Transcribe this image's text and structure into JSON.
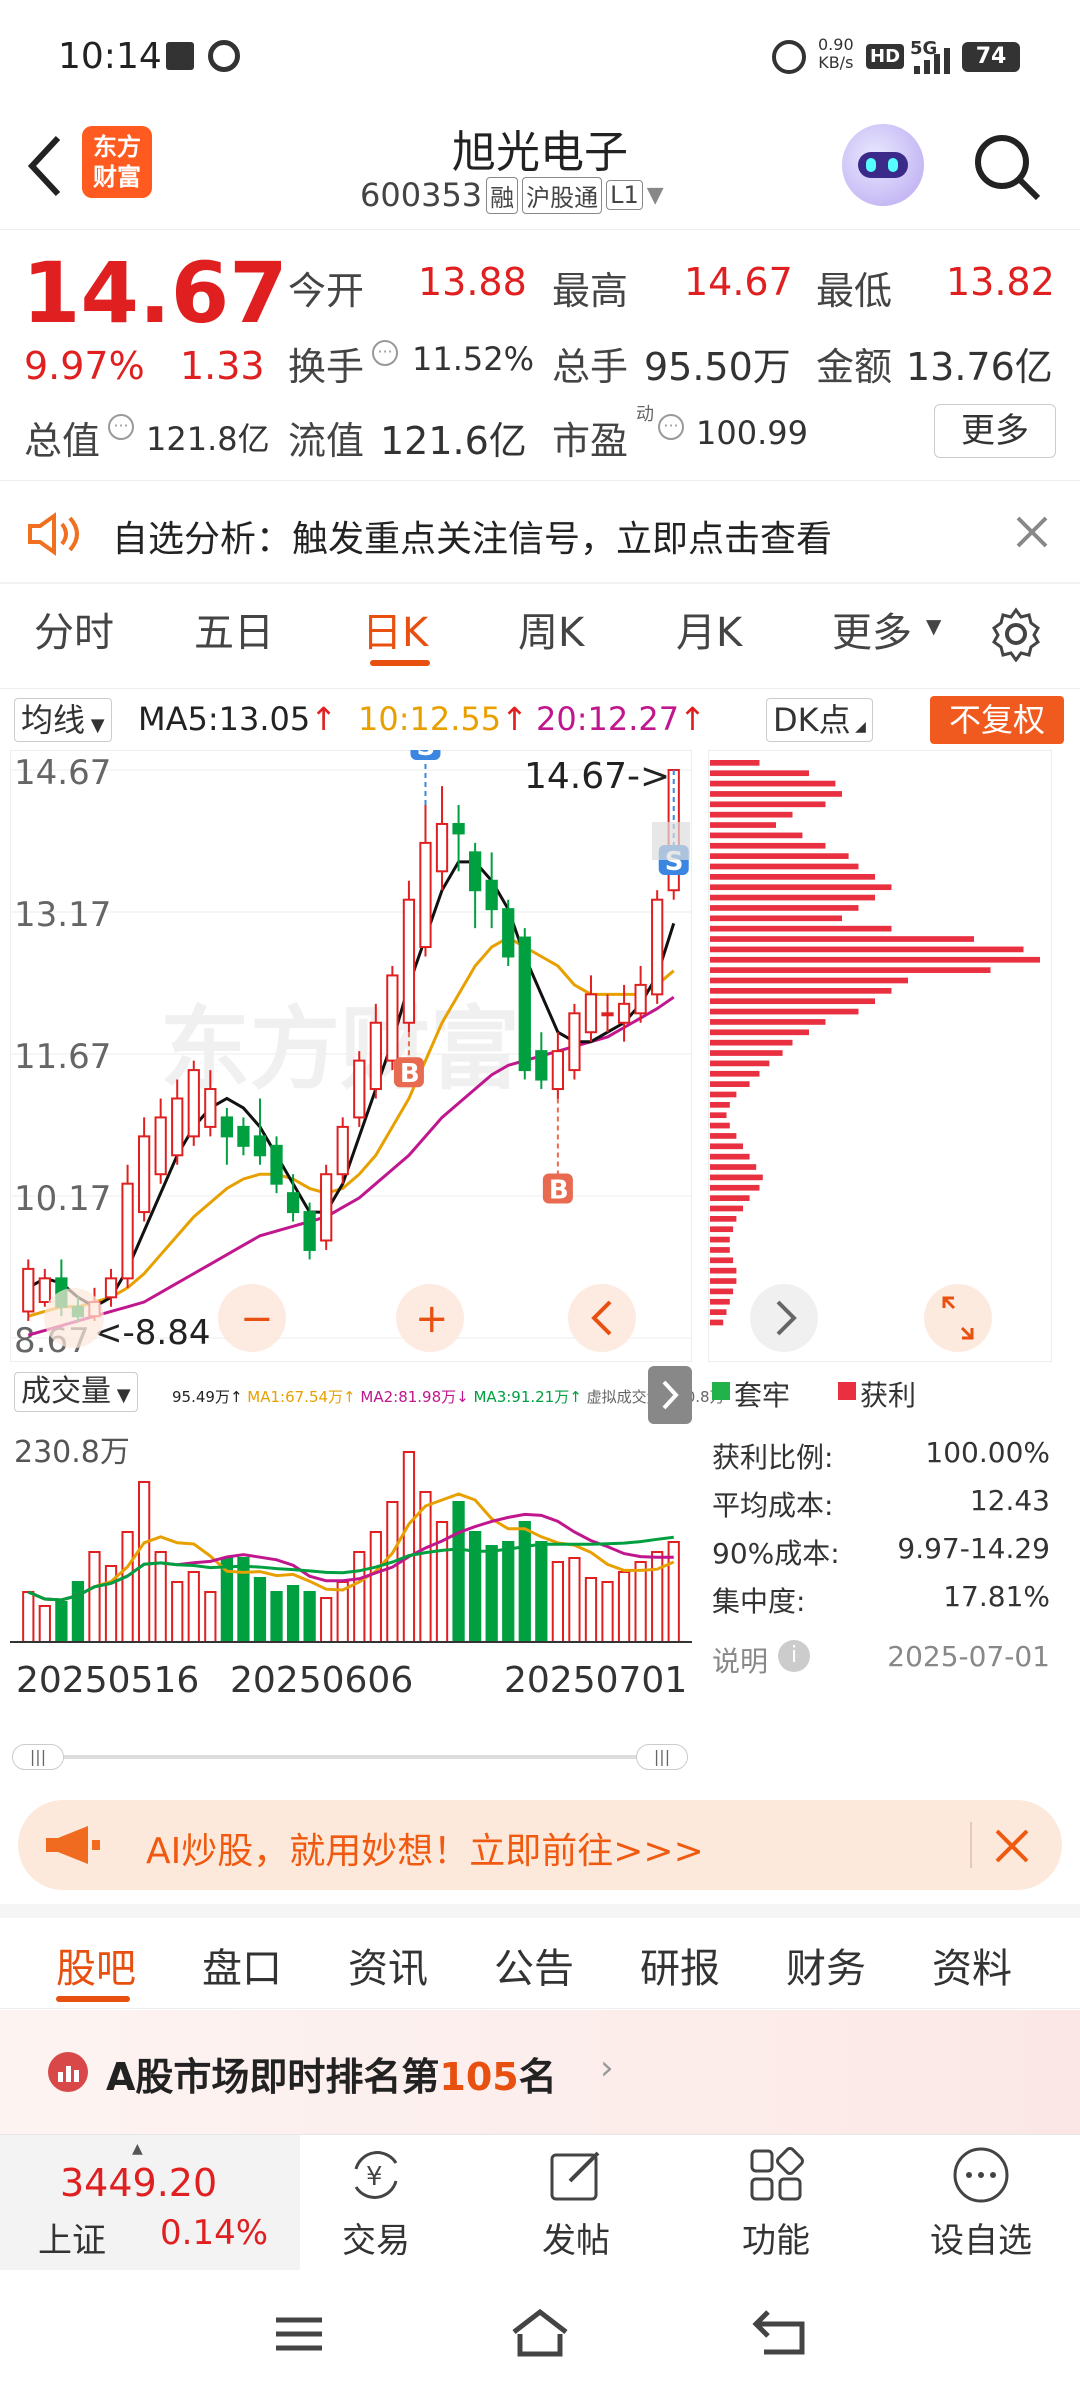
{
  "status": {
    "time": "10:14",
    "net_speed": "0.90",
    "net_unit": "KB/s",
    "hd": "HD",
    "signal": "5G",
    "battery": "74"
  },
  "header": {
    "title": "旭光电子",
    "code": "600353",
    "tag_margin": "融",
    "tag_connect": "沪股通",
    "tag_level": "L1",
    "brand_line1": "东方",
    "brand_line2": "财富"
  },
  "quote": {
    "price": "14.67",
    "change_pct": "9.97%",
    "change": "1.33",
    "open_label": "今开",
    "open": "13.88",
    "high_label": "最高",
    "high": "14.67",
    "low_label": "最低",
    "low": "13.82",
    "turnover_label": "换手",
    "turnover": "11.52%",
    "volume_label": "总手",
    "volume": "95.50万",
    "amount_label": "金额",
    "amount": "13.76亿",
    "mcap_label": "总值",
    "mcap": "121.8亿",
    "float_label": "流值",
    "float": "121.6亿",
    "pe_label": "市盈",
    "pe_sup": "动",
    "pe": "100.99",
    "more": "更多"
  },
  "banner": {
    "text": "自选分析：触发重点关注信号，立即点击查看"
  },
  "chart_tabs": [
    "分时",
    "五日",
    "日K",
    "周K",
    "月K",
    "更多"
  ],
  "ma_bar": {
    "selector": "均线",
    "ma5": "MA5:13.05",
    "ma10": "10:12.55",
    "ma20": "20:12.27",
    "dk": "DK点",
    "adjust": "不复权"
  },
  "chart_data": {
    "type": "candlestick",
    "yticks": [
      "14.67",
      "13.17",
      "11.67",
      "10.17",
      "8.67"
    ],
    "ylim": [
      8.67,
      14.67
    ],
    "last_label": "14.67->",
    "min_label": "<-8.84",
    "signals": [
      {
        "type": "B"
      },
      {
        "type": "S"
      },
      {
        "type": "B"
      },
      {
        "type": "S"
      },
      {
        "type": "S"
      }
    ],
    "candles": [
      {
        "o": 8.95,
        "c": 9.4,
        "h": 9.5,
        "l": 8.85
      },
      {
        "o": 9.05,
        "c": 9.3,
        "h": 9.4,
        "l": 9.0
      },
      {
        "o": 9.3,
        "c": 9.0,
        "h": 9.5,
        "l": 8.9
      },
      {
        "o": 9.0,
        "c": 8.9,
        "h": 9.1,
        "l": 8.84
      },
      {
        "o": 8.9,
        "c": 9.05,
        "h": 9.2,
        "l": 8.85
      },
      {
        "o": 9.1,
        "c": 9.3,
        "h": 9.4,
        "l": 9.0
      },
      {
        "o": 9.3,
        "c": 10.3,
        "h": 10.5,
        "l": 9.2
      },
      {
        "o": 10.0,
        "c": 10.8,
        "h": 11.0,
        "l": 9.9
      },
      {
        "o": 10.4,
        "c": 11.0,
        "h": 11.2,
        "l": 10.3
      },
      {
        "o": 10.6,
        "c": 11.2,
        "h": 11.4,
        "l": 10.5
      },
      {
        "o": 10.8,
        "c": 11.5,
        "h": 11.6,
        "l": 10.7
      },
      {
        "o": 10.9,
        "c": 11.3,
        "h": 11.5,
        "l": 10.8
      },
      {
        "o": 11.0,
        "c": 10.8,
        "h": 11.1,
        "l": 10.5
      },
      {
        "o": 10.9,
        "c": 10.7,
        "h": 11.0,
        "l": 10.6
      },
      {
        "o": 10.8,
        "c": 10.6,
        "h": 11.2,
        "l": 10.5
      },
      {
        "o": 10.7,
        "c": 10.3,
        "h": 10.8,
        "l": 10.2
      },
      {
        "o": 10.2,
        "c": 10.0,
        "h": 10.4,
        "l": 9.9
      },
      {
        "o": 10.0,
        "c": 9.6,
        "h": 10.1,
        "l": 9.5
      },
      {
        "o": 9.7,
        "c": 10.4,
        "h": 10.5,
        "l": 9.6
      },
      {
        "o": 10.4,
        "c": 10.9,
        "h": 11.0,
        "l": 10.3
      },
      {
        "o": 11.0,
        "c": 11.6,
        "h": 11.7,
        "l": 10.9
      },
      {
        "o": 11.3,
        "c": 12.0,
        "h": 12.2,
        "l": 11.2
      },
      {
        "o": 11.6,
        "c": 12.5,
        "h": 12.6,
        "l": 11.5
      },
      {
        "o": 12.0,
        "c": 13.3,
        "h": 13.5,
        "l": 11.9
      },
      {
        "o": 12.8,
        "c": 13.9,
        "h": 14.3,
        "l": 12.7
      },
      {
        "o": 13.6,
        "c": 14.1,
        "h": 14.5,
        "l": 13.4
      },
      {
        "o": 14.1,
        "c": 14.0,
        "h": 14.3,
        "l": 13.6
      },
      {
        "o": 13.8,
        "c": 13.4,
        "h": 13.9,
        "l": 13.0
      },
      {
        "o": 13.5,
        "c": 13.2,
        "h": 13.8,
        "l": 13.0
      },
      {
        "o": 13.2,
        "c": 12.7,
        "h": 13.3,
        "l": 12.6
      },
      {
        "o": 12.9,
        "c": 11.5,
        "h": 13.0,
        "l": 11.4
      },
      {
        "o": 11.7,
        "c": 11.4,
        "h": 11.9,
        "l": 11.3
      },
      {
        "o": 11.3,
        "c": 11.7,
        "h": 11.9,
        "l": 11.2
      },
      {
        "o": 11.5,
        "c": 12.1,
        "h": 12.2,
        "l": 11.4
      },
      {
        "o": 11.9,
        "c": 12.3,
        "h": 12.5,
        "l": 11.8
      },
      {
        "o": 12.1,
        "c": 12.1,
        "h": 12.3,
        "l": 11.9
      },
      {
        "o": 12.0,
        "c": 12.2,
        "h": 12.4,
        "l": 11.8
      },
      {
        "o": 12.1,
        "c": 12.4,
        "h": 12.6,
        "l": 12.0
      },
      {
        "o": 12.3,
        "c": 13.3,
        "h": 13.4,
        "l": 12.2
      },
      {
        "o": 13.4,
        "c": 14.67,
        "h": 14.67,
        "l": 13.3
      }
    ],
    "ma5": [
      9.2,
      9.3,
      9.25,
      9.1,
      9.0,
      9.1,
      9.4,
      9.8,
      10.2,
      10.6,
      10.9,
      11.1,
      11.2,
      11.1,
      10.9,
      10.6,
      10.3,
      10.0,
      10.0,
      10.3,
      10.8,
      11.3,
      11.8,
      12.4,
      12.9,
      13.4,
      13.7,
      13.7,
      13.5,
      13.2,
      12.7,
      12.3,
      11.9,
      11.8,
      11.8,
      11.9,
      12.0,
      12.2,
      12.5,
      13.05
    ],
    "ma10": [
      8.9,
      8.95,
      9.0,
      9.0,
      9.05,
      9.1,
      9.2,
      9.35,
      9.55,
      9.75,
      9.95,
      10.1,
      10.25,
      10.35,
      10.4,
      10.4,
      10.35,
      10.25,
      10.2,
      10.25,
      10.4,
      10.6,
      10.9,
      11.2,
      11.6,
      12.0,
      12.3,
      12.6,
      12.8,
      12.9,
      12.8,
      12.7,
      12.6,
      12.4,
      12.3,
      12.3,
      12.3,
      12.3,
      12.4,
      12.55
    ],
    "ma20": [
      8.7,
      8.75,
      8.8,
      8.85,
      8.9,
      8.95,
      9.0,
      9.05,
      9.15,
      9.25,
      9.35,
      9.45,
      9.55,
      9.65,
      9.75,
      9.8,
      9.85,
      9.9,
      9.95,
      10.05,
      10.15,
      10.3,
      10.45,
      10.6,
      10.8,
      11.0,
      11.15,
      11.3,
      11.45,
      11.55,
      11.6,
      11.65,
      11.7,
      11.75,
      11.8,
      11.85,
      11.95,
      12.05,
      12.15,
      12.27
    ]
  },
  "chips": {
    "legend_trapped": "套牢",
    "legend_profit": "获利",
    "stats": [
      {
        "label": "获利比例:",
        "value": "100.00%"
      },
      {
        "label": "平均成本:",
        "value": "12.43"
      },
      {
        "label": "90%成本:",
        "value": "9.97-14.29"
      },
      {
        "label": "集中度:",
        "value": "17.81%"
      }
    ],
    "note": "说明",
    "date": "2025-07-01",
    "bars": [
      0.15,
      0.3,
      0.38,
      0.4,
      0.35,
      0.25,
      0.2,
      0.28,
      0.35,
      0.42,
      0.45,
      0.5,
      0.55,
      0.5,
      0.45,
      0.4,
      0.55,
      0.8,
      0.95,
      1.0,
      0.85,
      0.6,
      0.55,
      0.5,
      0.45,
      0.35,
      0.3,
      0.25,
      0.22,
      0.18,
      0.15,
      0.12,
      0.08,
      0.06,
      0.05,
      0.06,
      0.08,
      0.1,
      0.12,
      0.14,
      0.16,
      0.15,
      0.12,
      0.1,
      0.08,
      0.07,
      0.06,
      0.06,
      0.07,
      0.08,
      0.08,
      0.07,
      0.06,
      0.05,
      0.04
    ]
  },
  "volume": {
    "selector": "成交量",
    "legend": [
      "95.49万↑",
      "MA1:67.54万↑",
      "MA2:81.98万↓",
      "MA3:91.21万↑",
      "虚拟成交量:230.8万"
    ],
    "ymax_label": "230.8万",
    "dates": [
      "20250516",
      "20250606",
      "20250701"
    ],
    "values": [
      0.25,
      0.18,
      0.2,
      0.3,
      0.45,
      0.38,
      0.55,
      0.8,
      0.45,
      0.3,
      0.35,
      0.25,
      0.42,
      0.42,
      0.32,
      0.25,
      0.28,
      0.25,
      0.22,
      0.3,
      0.45,
      0.55,
      0.7,
      0.95,
      0.75,
      0.6,
      0.7,
      0.55,
      0.48,
      0.5,
      0.6,
      0.5,
      0.4,
      0.42,
      0.32,
      0.3,
      0.35,
      0.4,
      0.45,
      0.5
    ]
  },
  "ai_banner": {
    "text": "AI炒股，就用妙想！立即前往>>>"
  },
  "bottom_tabs": [
    "股吧",
    "盘口",
    "资讯",
    "公告",
    "研报",
    "财务",
    "资料"
  ],
  "rank": {
    "prefix": "A股市场即时排名第",
    "number": "105",
    "suffix": "名"
  },
  "index": {
    "value": "3449.20",
    "name": "上证",
    "pct": "0.14%"
  },
  "nav": [
    "交易",
    "发帖",
    "功能",
    "设自选"
  ]
}
